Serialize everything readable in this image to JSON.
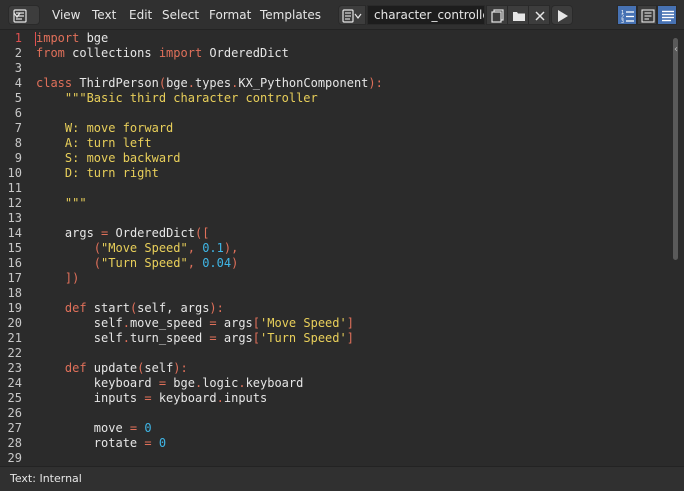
{
  "header": {
    "editor_type_icon": "text-editor-icon",
    "menus": [
      "View",
      "Text",
      "Edit",
      "Select",
      "Format",
      "Templates"
    ],
    "text_datablock": "character_controller...",
    "buttons": [
      "new-text-icon",
      "open-folder-icon",
      "close-icon",
      "run-script-icon"
    ],
    "toggles": [
      {
        "name": "line-numbers-icon",
        "active": true
      },
      {
        "name": "word-wrap-icon",
        "active": false
      },
      {
        "name": "syntax-highlight-icon",
        "active": true
      }
    ]
  },
  "editor": {
    "current_line": 1,
    "lines": [
      [
        {
          "t": "import",
          "c": "k"
        },
        {
          "t": " bge",
          "c": "p"
        }
      ],
      [
        {
          "t": "from",
          "c": "k"
        },
        {
          "t": " collections ",
          "c": "p"
        },
        {
          "t": "import",
          "c": "k"
        },
        {
          "t": " OrderedDict",
          "c": "p"
        }
      ],
      [],
      [
        {
          "t": "class",
          "c": "k"
        },
        {
          "t": " ThirdPerson",
          "c": "p"
        },
        {
          "t": "(",
          "c": "o"
        },
        {
          "t": "bge",
          "c": "p"
        },
        {
          "t": ".",
          "c": "o"
        },
        {
          "t": "types",
          "c": "p"
        },
        {
          "t": ".",
          "c": "o"
        },
        {
          "t": "KX_PythonComponent",
          "c": "p"
        },
        {
          "t": "):",
          "c": "o"
        }
      ],
      [
        {
          "t": "    \"\"\"Basic third character controller",
          "c": "s"
        }
      ],
      [],
      [
        {
          "t": "    W: move forward",
          "c": "s"
        }
      ],
      [
        {
          "t": "    A: turn left",
          "c": "s"
        }
      ],
      [
        {
          "t": "    S: move backward",
          "c": "s"
        }
      ],
      [
        {
          "t": "    D: turn right",
          "c": "s"
        }
      ],
      [],
      [
        {
          "t": "    \"\"\"",
          "c": "s"
        }
      ],
      [],
      [
        {
          "t": "    args ",
          "c": "p"
        },
        {
          "t": "=",
          "c": "o"
        },
        {
          "t": " OrderedDict",
          "c": "p"
        },
        {
          "t": "([",
          "c": "o"
        }
      ],
      [
        {
          "t": "        (",
          "c": "o"
        },
        {
          "t": "\"Move Speed\"",
          "c": "s"
        },
        {
          "t": ", ",
          "c": "o"
        },
        {
          "t": "0.1",
          "c": "n"
        },
        {
          "t": "),",
          "c": "o"
        }
      ],
      [
        {
          "t": "        (",
          "c": "o"
        },
        {
          "t": "\"Turn Speed\"",
          "c": "s"
        },
        {
          "t": ", ",
          "c": "o"
        },
        {
          "t": "0.04",
          "c": "n"
        },
        {
          "t": ")",
          "c": "o"
        }
      ],
      [
        {
          "t": "    ])",
          "c": "o"
        }
      ],
      [],
      [
        {
          "t": "    def",
          "c": "k"
        },
        {
          "t": " start",
          "c": "p"
        },
        {
          "t": "(",
          "c": "o"
        },
        {
          "t": "self, args",
          "c": "p"
        },
        {
          "t": "):",
          "c": "o"
        }
      ],
      [
        {
          "t": "        self",
          "c": "p"
        },
        {
          "t": ".",
          "c": "o"
        },
        {
          "t": "move_speed ",
          "c": "p"
        },
        {
          "t": "=",
          "c": "o"
        },
        {
          "t": " args",
          "c": "p"
        },
        {
          "t": "[",
          "c": "o"
        },
        {
          "t": "'Move Speed'",
          "c": "s"
        },
        {
          "t": "]",
          "c": "o"
        }
      ],
      [
        {
          "t": "        self",
          "c": "p"
        },
        {
          "t": ".",
          "c": "o"
        },
        {
          "t": "turn_speed ",
          "c": "p"
        },
        {
          "t": "=",
          "c": "o"
        },
        {
          "t": " args",
          "c": "p"
        },
        {
          "t": "[",
          "c": "o"
        },
        {
          "t": "'Turn Speed'",
          "c": "s"
        },
        {
          "t": "]",
          "c": "o"
        }
      ],
      [],
      [
        {
          "t": "    def",
          "c": "k"
        },
        {
          "t": " update",
          "c": "p"
        },
        {
          "t": "(",
          "c": "o"
        },
        {
          "t": "self",
          "c": "p"
        },
        {
          "t": "):",
          "c": "o"
        }
      ],
      [
        {
          "t": "        keyboard ",
          "c": "p"
        },
        {
          "t": "=",
          "c": "o"
        },
        {
          "t": " bge",
          "c": "p"
        },
        {
          "t": ".",
          "c": "o"
        },
        {
          "t": "logic",
          "c": "p"
        },
        {
          "t": ".",
          "c": "o"
        },
        {
          "t": "keyboard",
          "c": "p"
        }
      ],
      [
        {
          "t": "        inputs ",
          "c": "p"
        },
        {
          "t": "=",
          "c": "o"
        },
        {
          "t": " keyboard",
          "c": "p"
        },
        {
          "t": ".",
          "c": "o"
        },
        {
          "t": "inputs",
          "c": "p"
        }
      ],
      [],
      [
        {
          "t": "        move ",
          "c": "p"
        },
        {
          "t": "=",
          "c": "o"
        },
        {
          "t": " ",
          "c": "p"
        },
        {
          "t": "0",
          "c": "n"
        }
      ],
      [
        {
          "t": "        rotate ",
          "c": "p"
        },
        {
          "t": "=",
          "c": "o"
        },
        {
          "t": " ",
          "c": "p"
        },
        {
          "t": "0",
          "c": "n"
        }
      ],
      [],
      []
    ]
  },
  "footer": {
    "status": "Text: Internal"
  },
  "colors": {
    "keyword": "#e0705a",
    "string": "#e8cf5a",
    "number": "#3fb6e6",
    "accent": "#4772b3"
  }
}
